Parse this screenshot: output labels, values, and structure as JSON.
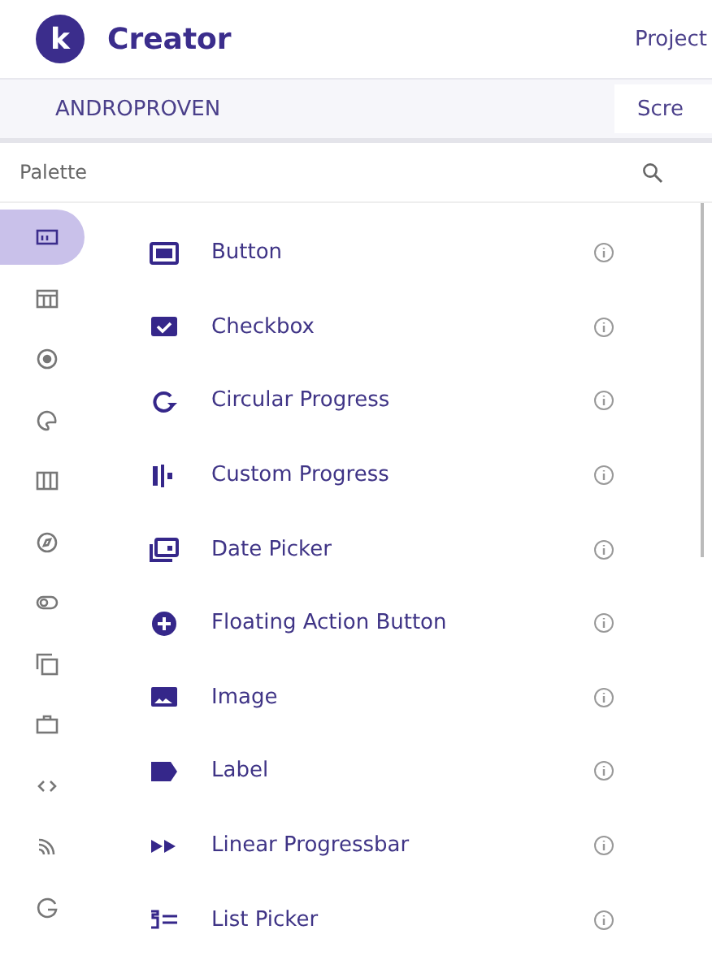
{
  "header": {
    "logo_letter": "k",
    "app_name": "Creator",
    "menu_item": "Project"
  },
  "project_bar": {
    "project_name": "ANDROPROVEN",
    "tab": "Scre"
  },
  "palette": {
    "title": "Palette"
  },
  "categories": [
    {
      "selected": true
    },
    {
      "selected": false
    },
    {
      "selected": false
    },
    {
      "selected": false
    },
    {
      "selected": false
    },
    {
      "selected": false
    },
    {
      "selected": false
    },
    {
      "selected": false
    },
    {
      "selected": false
    },
    {
      "selected": false
    },
    {
      "selected": false
    },
    {
      "selected": false
    }
  ],
  "components": [
    {
      "label": "Button"
    },
    {
      "label": "Checkbox"
    },
    {
      "label": "Circular Progress"
    },
    {
      "label": "Custom Progress"
    },
    {
      "label": "Date Picker"
    },
    {
      "label": "Floating Action Button"
    },
    {
      "label": "Image"
    },
    {
      "label": "Label"
    },
    {
      "label": "Linear Progressbar"
    },
    {
      "label": "List Picker"
    }
  ]
}
